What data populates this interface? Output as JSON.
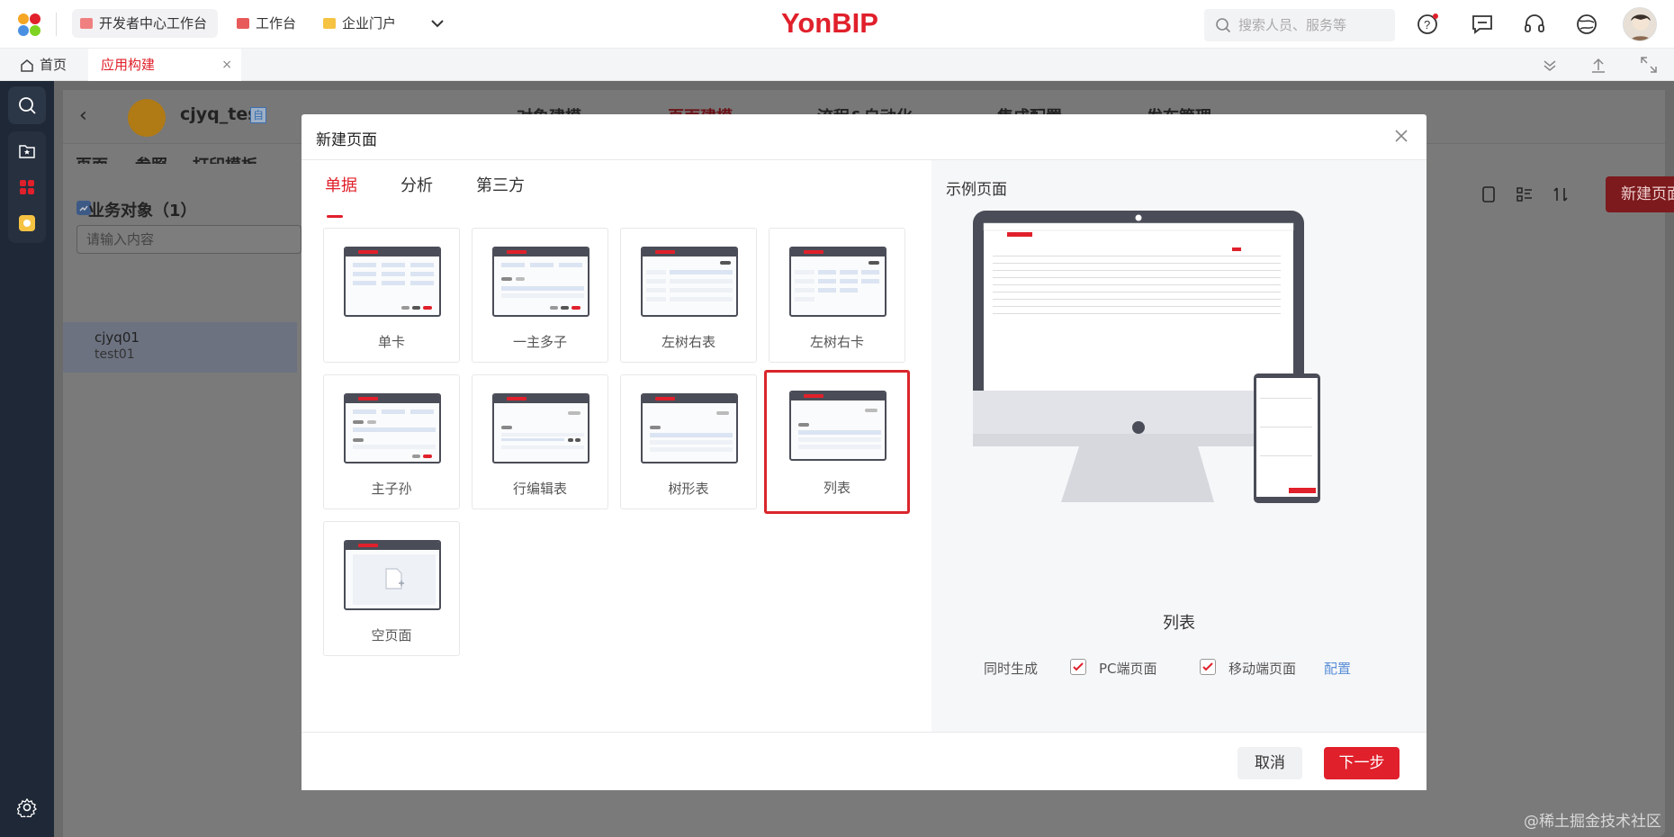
{
  "topbar": {
    "tabs": [
      {
        "label": "开发者中心工作台"
      },
      {
        "label": "工作台"
      },
      {
        "label": "企业门户"
      }
    ],
    "brand": "YonBIP",
    "search_placeholder": "搜索人员、服务等"
  },
  "tabbar": {
    "home": "首页",
    "active_tab": "应用构建",
    "close": "×"
  },
  "workspace": {
    "app_name": "cjyq_test",
    "app_tag": "自",
    "nav": [
      "对象建模",
      "页面建模",
      "流程&自动化",
      "集成配置",
      "发布管理"
    ],
    "subtabs": [
      "页面",
      "参照",
      "打印模板"
    ],
    "list_title": "业务对象（1）",
    "search_placeholder": "请输入内容",
    "items": [
      {
        "name": "cjyq01",
        "code": "test01"
      }
    ],
    "new_page_button": "新建页面"
  },
  "modal": {
    "title": "新建页面",
    "categories": [
      "单据",
      "分析",
      "第三方"
    ],
    "templates": [
      "单卡",
      "一主多子",
      "左树右表",
      "左树右卡",
      "主子孙",
      "行编辑表",
      "树形表",
      "列表",
      "空页面"
    ],
    "selected": "列表",
    "example_title": "示例页面",
    "example_label": "列表",
    "options": {
      "generate_label": "同时生成",
      "pc_label": "PC端页面",
      "mobile_label": "移动端页面",
      "config_link": "配置"
    },
    "cancel": "取消",
    "next": "下一步"
  },
  "watermark": "@稀土掘金技术社区",
  "colors": {
    "accent": "#e0202b",
    "sidebar": "#1e2836"
  }
}
